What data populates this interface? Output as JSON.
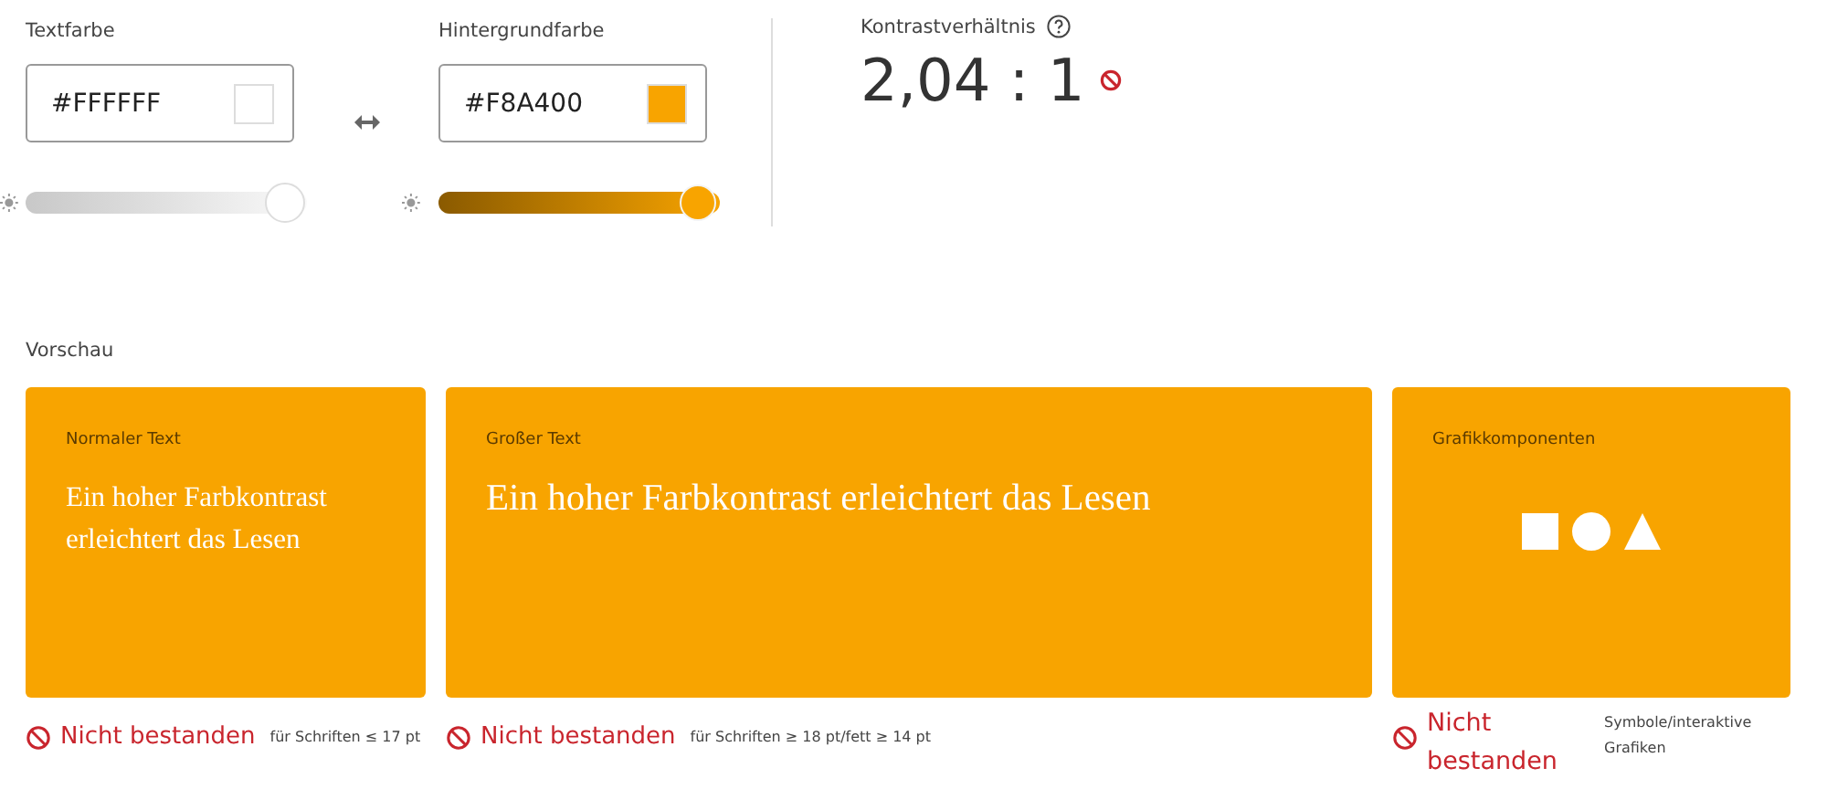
{
  "colors": [
    {
      "label": "Textfarbe",
      "value": "#FFFFFF",
      "level": 0.95
    },
    {
      "label": "Hintergrundfarbe",
      "value": "#F8A400",
      "level": 0.95
    }
  ],
  "contrast": {
    "label": "Kontrastverhältnis",
    "ratio": "2,04 : 1",
    "passed": false
  },
  "preview": {
    "label": "Vorschau",
    "cards": [
      {
        "kind": "text",
        "title": "Normaler Text",
        "sample": "Ein hoher Farbkontrast erleichtert das Lesen",
        "result": "Nicht bestanden",
        "passed": false,
        "note": "für Schriften ≤ 17 pt"
      },
      {
        "kind": "large",
        "title": "Großer Text",
        "sample": "Ein hoher Farbkontrast erleichtert das Lesen",
        "result": "Nicht bestanden",
        "passed": false,
        "note": "für Schriften ≥ 18 pt/fett ≥ 14 pt"
      },
      {
        "kind": "graphics",
        "title": "Grafikkomponenten",
        "result": "Nicht bestanden",
        "passed": false,
        "note": "Symbole/interaktive Grafiken"
      }
    ]
  }
}
